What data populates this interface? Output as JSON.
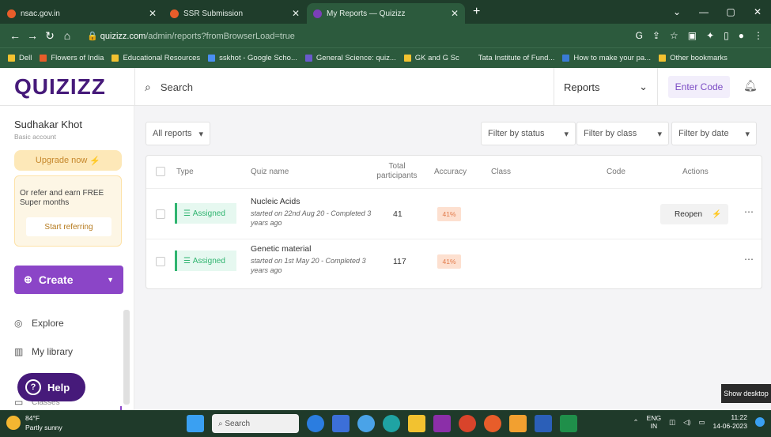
{
  "browser": {
    "tabs": [
      {
        "title": "nsac.gov.in",
        "color": "#e85d2a",
        "active": false
      },
      {
        "title": "SSR Submission",
        "color": "#e85d2a",
        "active": false
      },
      {
        "title": "My Reports — Quizizz",
        "color": "#7b3fb8",
        "active": true
      }
    ],
    "url_host": "quizizz.com",
    "url_path": "/admin/reports?fromBrowserLoad=true",
    "bookmarks": [
      {
        "label": "Dell",
        "color": "#f2c230"
      },
      {
        "label": "Flowers of India",
        "color": "#e85d2a"
      },
      {
        "label": "Educational Resources",
        "color": "#f2c230"
      },
      {
        "label": "sskhot - Google Scho...",
        "color": "#4a8ff2"
      },
      {
        "label": "General Science: quiz...",
        "color": "#6a5acd"
      },
      {
        "label": "GK and G Sc",
        "color": "#f2c230"
      },
      {
        "label": "Tata Institute of Fund...",
        "color": "#2c5a3d"
      },
      {
        "label": "How to make your pa...",
        "color": "#3a7bd5"
      },
      {
        "label": "Other bookmarks",
        "color": "#f2c230"
      }
    ]
  },
  "header": {
    "logo": "QUIZIZZ",
    "search_placeholder": "Search",
    "reports_label": "Reports",
    "enter_code": "Enter Code"
  },
  "sidebar": {
    "user_name": "Sudhakar Khot",
    "account_type": "Basic account",
    "upgrade": "Upgrade now",
    "refer_text": "Or refer and earn FREE Super months",
    "refer_button": "Start referring",
    "create": "Create",
    "nav": [
      {
        "label": "Explore"
      },
      {
        "label": "My library"
      },
      {
        "label": "Classes"
      }
    ],
    "help": "Help"
  },
  "filters": {
    "all_reports": "All reports",
    "by_status": "Filter by status",
    "by_class": "Filter by class",
    "by_date": "Filter by date"
  },
  "table": {
    "headers": {
      "type": "Type",
      "quiz_name": "Quiz name",
      "participants": "Total participants",
      "accuracy": "Accuracy",
      "class": "Class",
      "code": "Code",
      "actions": "Actions"
    },
    "rows": [
      {
        "type": "Assigned",
        "name": "Nucleic Acids",
        "status": "started on 22nd Aug 20 - Completed 3 years ago",
        "participants": "41",
        "accuracy": "41%",
        "action": "Reopen"
      },
      {
        "type": "Assigned",
        "name": "Genetic material",
        "status": "started on 1st May 20 - Completed 3 years ago",
        "participants": "117",
        "accuracy": "41%",
        "action": ""
      }
    ]
  },
  "tooltip": "Show desktop",
  "taskbar": {
    "temp": "84°F",
    "weather": "Partly sunny",
    "search": "Search",
    "lang1": "ENG",
    "lang2": "IN",
    "time": "11:22",
    "date": "14-06-2023"
  }
}
